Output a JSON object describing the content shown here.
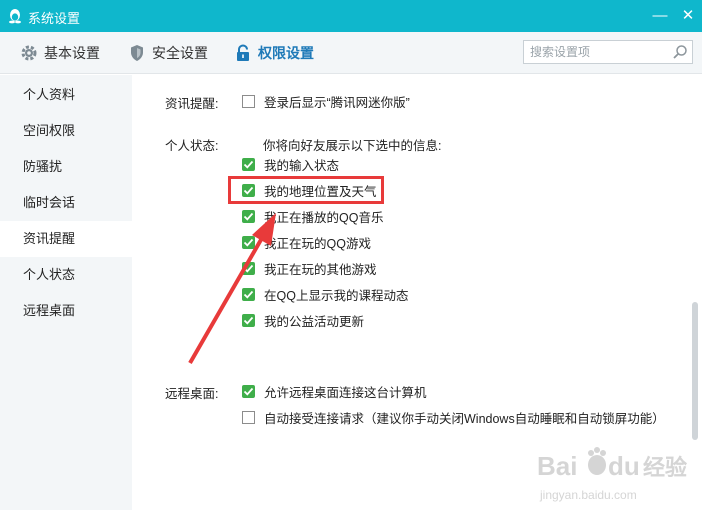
{
  "window": {
    "title": "系统设置",
    "minimize": "—",
    "close": "✕"
  },
  "tabs": [
    {
      "label": "基本设置",
      "icon": "gear-icon"
    },
    {
      "label": "安全设置",
      "icon": "shield-icon"
    },
    {
      "label": "权限设置",
      "icon": "lock-icon",
      "active": true
    }
  ],
  "search": {
    "placeholder": "搜索设置项",
    "icon": "search-icon"
  },
  "sidebar": {
    "items": [
      {
        "label": "个人资料"
      },
      {
        "label": "空间权限"
      },
      {
        "label": "防骚扰"
      },
      {
        "label": "临时会话"
      },
      {
        "label": "资讯提醒",
        "active": true
      },
      {
        "label": "个人状态"
      },
      {
        "label": "远程桌面"
      }
    ]
  },
  "sections": {
    "news": {
      "label": "资讯提醒:",
      "option": {
        "text": "登录后显示“腾讯网迷你版”",
        "checked": false
      }
    },
    "status": {
      "label": "个人状态:",
      "intro": "你将向好友展示以下选中的信息:",
      "options": [
        {
          "text": "我的输入状态",
          "checked": true
        },
        {
          "text": "我的地理位置及天气",
          "checked": true
        },
        {
          "text": "我正在播放的QQ音乐",
          "checked": true
        },
        {
          "text": "我正在玩的QQ游戏",
          "checked": true
        },
        {
          "text": "我正在玩的其他游戏",
          "checked": true
        },
        {
          "text": "在QQ上显示我的课程动态",
          "checked": true
        },
        {
          "text": "我的公益活动更新",
          "checked": true
        }
      ]
    },
    "remote": {
      "label": "远程桌面:",
      "options": [
        {
          "text": "允许远程桌面连接这台计算机",
          "checked": true
        },
        {
          "text": "自动接受连接请求（建议你手动关闭Windows自动睡眠和自动锁屏功能）",
          "checked": false
        }
      ]
    }
  },
  "colors": {
    "titlebar": "#0fb7cc",
    "accent": "#1f7ab8",
    "checkbox": "#3fae4a",
    "highlight": "#e83a3a"
  },
  "watermark": {
    "brand": "Baidu",
    "cn": "经验",
    "url": "jingyan.baidu.com"
  }
}
